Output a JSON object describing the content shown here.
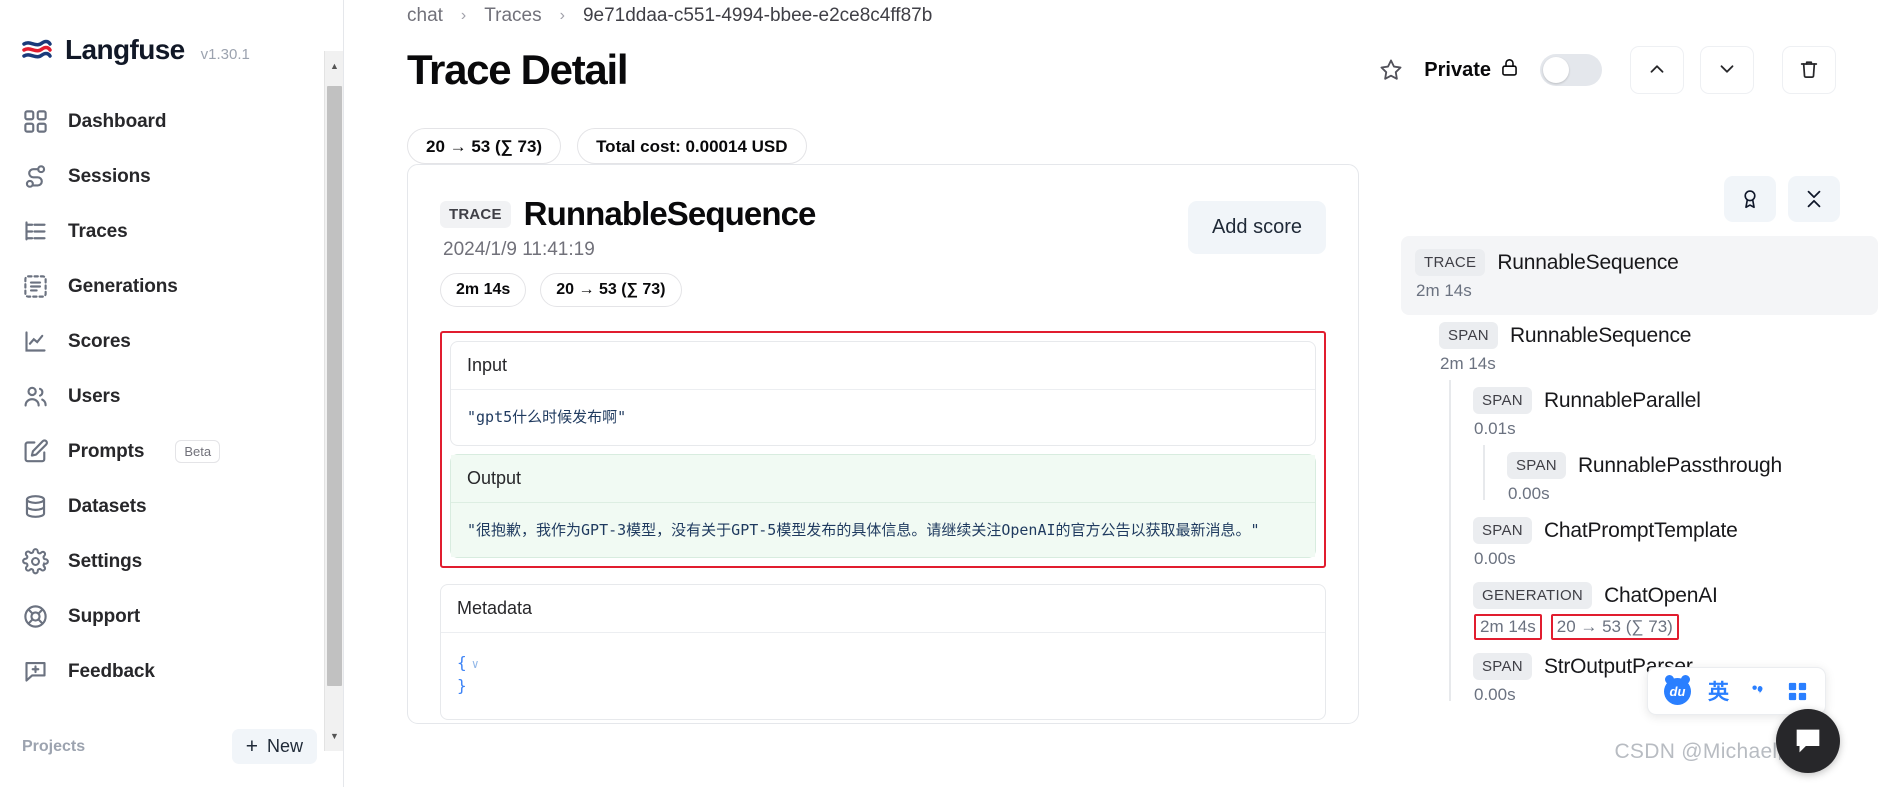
{
  "sidebar": {
    "brand": {
      "name": "Langfuse",
      "version": "v1.30.1",
      "logo_icon": "langfuse-logo-icon"
    },
    "items": [
      {
        "label": "Dashboard",
        "icon": "grid-icon"
      },
      {
        "label": "Sessions",
        "icon": "sessions-flow-icon"
      },
      {
        "label": "Traces",
        "icon": "traces-list-icon"
      },
      {
        "label": "Generations",
        "icon": "generations-dashed-list-icon"
      },
      {
        "label": "Scores",
        "icon": "line-chart-icon"
      },
      {
        "label": "Users",
        "icon": "users-icon"
      },
      {
        "label": "Prompts",
        "icon": "pencil-square-icon",
        "badge": "Beta"
      },
      {
        "label": "Datasets",
        "icon": "database-icon"
      },
      {
        "label": "Settings",
        "icon": "gear-icon"
      },
      {
        "label": "Support",
        "icon": "lifebuoy-icon"
      },
      {
        "label": "Feedback",
        "icon": "comment-plus-icon"
      }
    ],
    "projects_label": "Projects",
    "new_button": {
      "label": "New",
      "plus": "+"
    }
  },
  "header": {
    "breadcrumb": [
      "chat",
      "Traces",
      "9e71ddaa-c551-4994-bbee-e2ce8c4ff87b"
    ],
    "separator": "›",
    "title": "Trace Detail",
    "star_icon": "star-outline-icon",
    "visibility_label": "Private",
    "lock_icon": "lock-closed-icon",
    "toggle_state": "off",
    "prev_icon": "chevron-up-icon",
    "next_icon": "chevron-down-icon",
    "delete_icon": "trash-icon",
    "badges": [
      "20 → 53 (∑ 73)",
      "Total cost: 0.00014 USD"
    ]
  },
  "trace_card": {
    "type_tag": "TRACE",
    "name": "RunnableSequence",
    "timestamp": "2024/1/9 11:41:19",
    "pills": [
      "2m 14s",
      "20 → 53 (∑ 73)"
    ],
    "add_score_label": "Add score",
    "input": {
      "heading": "Input",
      "value": "\"gpt5什么时候发布啊\""
    },
    "output": {
      "heading": "Output",
      "value": "\"很抱歉，我作为GPT-3模型，没有关于GPT-5模型发布的具体信息。请继续关注OpenAI的官方公告以获取最新消息。\""
    },
    "metadata": {
      "heading": "Metadata",
      "line_open": "{",
      "line_close": "}",
      "caret": "∨"
    }
  },
  "tree_panel": {
    "tools": [
      {
        "name": "scores-ribbon-button",
        "icon": "ribbon-award-icon"
      },
      {
        "name": "collapse-button",
        "icon": "collapse-chevrons-icon"
      }
    ],
    "nodes": [
      {
        "tag": "TRACE",
        "name": "RunnableSequence",
        "duration": "2m 14s",
        "selected": true,
        "depth": 0
      },
      {
        "tag": "SPAN",
        "name": "RunnableSequence",
        "duration": "2m 14s",
        "depth": 1
      },
      {
        "tag": "SPAN",
        "name": "RunnableParallel",
        "duration": "0.01s",
        "depth": 2
      },
      {
        "tag": "SPAN",
        "name": "RunnablePassthrough",
        "duration": "0.00s",
        "depth": 3
      },
      {
        "tag": "SPAN",
        "name": "ChatPromptTemplate",
        "duration": "0.00s",
        "depth": 2
      },
      {
        "tag": "GENERATION",
        "name": "ChatOpenAI",
        "duration": "2m 14s",
        "usage": "20 → 53 (∑ 73)",
        "highlight": true,
        "depth": 2
      },
      {
        "tag": "SPAN",
        "name": "StrOutputParser",
        "duration": "0.00s",
        "depth": 2
      }
    ]
  },
  "overlays": {
    "ime": {
      "logo_text": "du",
      "lang": "英",
      "punct_icon": "punctuation-icon",
      "panel_icon": "keyboard-panel-icon"
    },
    "chat_fab_icon": "chat-bubble-icon",
    "watermark": "CSDN @Michael阿明"
  },
  "colors": {
    "accent_red": "#e11d2f",
    "ime_blue": "#2a7fff",
    "output_green_bg": "#f1faf3",
    "code_text": "#1f3a5f"
  }
}
